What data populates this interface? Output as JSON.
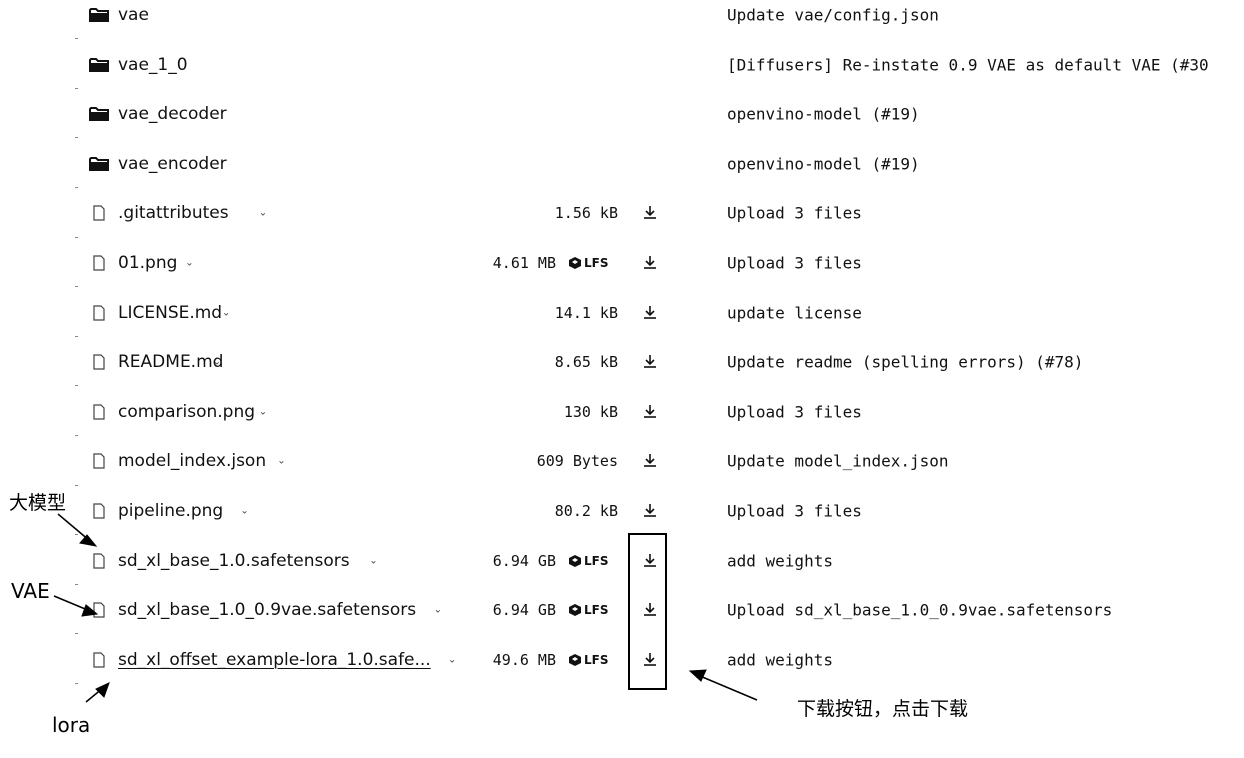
{
  "files": [
    {
      "type": "folder",
      "name": "vae",
      "size": "",
      "lfs": false,
      "download": false,
      "caret": false,
      "commit": "Update vae/config.json"
    },
    {
      "type": "folder",
      "name": "vae_1_0",
      "size": "",
      "lfs": false,
      "download": false,
      "caret": false,
      "commit": "[Diffusers] Re-instate 0.9 VAE as default VAE (#30"
    },
    {
      "type": "folder",
      "name": "vae_decoder",
      "size": "",
      "lfs": false,
      "download": false,
      "caret": false,
      "commit": "openvino-model (#19)"
    },
    {
      "type": "folder",
      "name": "vae_encoder",
      "size": "",
      "lfs": false,
      "download": false,
      "caret": false,
      "commit": "openvino-model (#19)"
    },
    {
      "type": "file",
      "name": ".gitattributes",
      "size": "1.56 kB",
      "lfs": false,
      "download": true,
      "caret": true,
      "commit": "Upload 3 files"
    },
    {
      "type": "file",
      "name": "01.png",
      "size": "4.61 MB",
      "lfs": true,
      "download": true,
      "caret": true,
      "commit": "Upload 3 files"
    },
    {
      "type": "file",
      "name": "LICENSE.md",
      "size": "14.1 kB",
      "lfs": false,
      "download": true,
      "caret": true,
      "commit": "update license"
    },
    {
      "type": "file",
      "name": "README.md",
      "size": "8.65 kB",
      "lfs": false,
      "download": true,
      "caret": true,
      "commit": "Update readme (spelling errors) (#78)"
    },
    {
      "type": "file",
      "name": "comparison.png",
      "size": "130 kB",
      "lfs": false,
      "download": true,
      "caret": true,
      "commit": "Upload 3 files"
    },
    {
      "type": "file",
      "name": "model_index.json",
      "size": "609 Bytes",
      "lfs": false,
      "download": true,
      "caret": true,
      "commit": "Update model_index.json"
    },
    {
      "type": "file",
      "name": "pipeline.png",
      "size": "80.2 kB",
      "lfs": false,
      "download": true,
      "caret": true,
      "commit": "Upload 3 files"
    },
    {
      "type": "file",
      "name": "sd_xl_base_1.0.safetensors",
      "size": "6.94 GB",
      "lfs": true,
      "download": true,
      "caret": true,
      "commit": "add weights"
    },
    {
      "type": "file",
      "name": "sd_xl_base_1.0_0.9vae.safetensors",
      "size": "6.94 GB",
      "lfs": true,
      "download": true,
      "caret": true,
      "commit": "Upload sd_xl_base_1.0_0.9vae.safetensors"
    },
    {
      "type": "file",
      "name": "sd_xl_offset_example-lora_1.0.safe...",
      "size": "49.6 MB",
      "lfs": true,
      "download": true,
      "caret": true,
      "commit": "add weights",
      "link": true
    }
  ],
  "lfs_label": "LFS",
  "annotations": {
    "big_model": "大模型",
    "vae": "VAE",
    "lora": "lora",
    "download_hint": "下载按钮，点击下载"
  },
  "icons": {
    "folder": "folder-icon",
    "file": "file-icon",
    "download": "download-icon",
    "lfs": "lfs-icon",
    "caret": "chevron-down-icon"
  },
  "colors": {
    "text": "#111111",
    "annotation": "#000000"
  }
}
